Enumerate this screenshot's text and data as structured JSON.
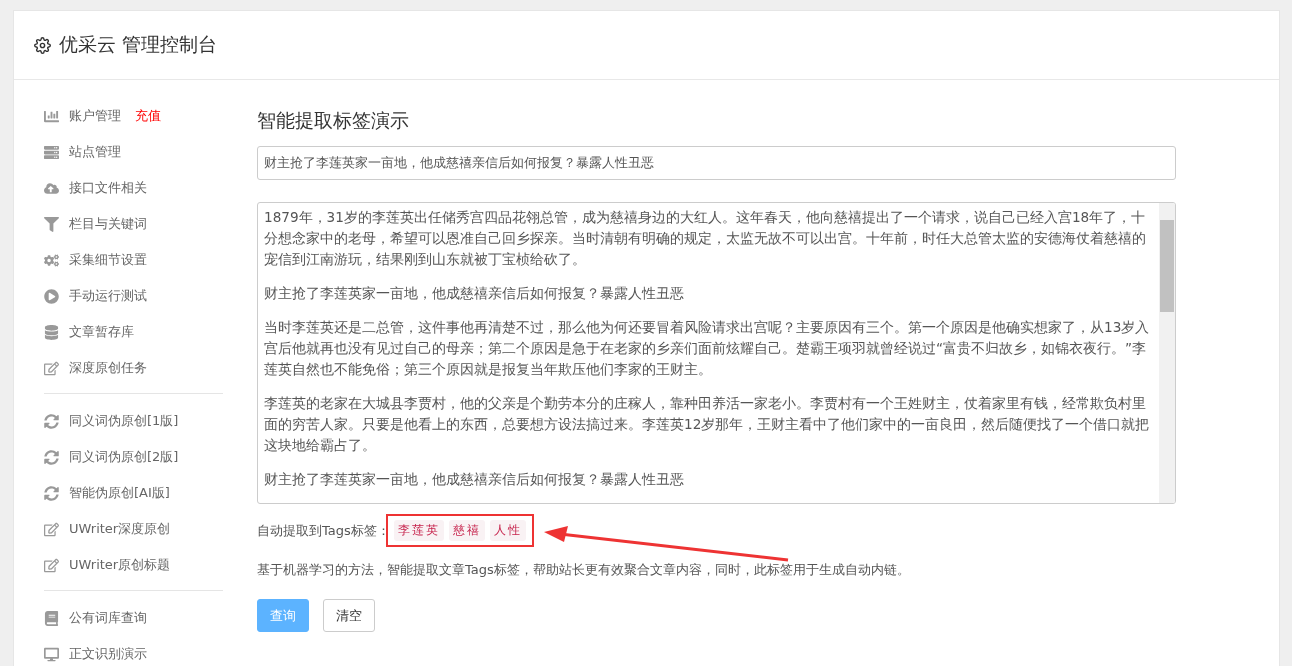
{
  "header": {
    "title": "优采云 管理控制台"
  },
  "sidebar": {
    "groups": [
      {
        "items": [
          {
            "label": "账户管理",
            "badge": "充值"
          },
          {
            "label": "站点管理"
          },
          {
            "label": "接口文件相关"
          },
          {
            "label": "栏目与关键词"
          },
          {
            "label": "采集细节设置"
          },
          {
            "label": "手动运行测试"
          },
          {
            "label": "文章暂存库"
          },
          {
            "label": "深度原创任务"
          }
        ]
      },
      {
        "items": [
          {
            "label": "同义词伪原创[1版]"
          },
          {
            "label": "同义词伪原创[2版]"
          },
          {
            "label": "智能伪原创[AI版]"
          },
          {
            "label": "UWriter深度原创"
          },
          {
            "label": "UWriter原创标题"
          }
        ]
      },
      {
        "items": [
          {
            "label": "公有词库查询"
          },
          {
            "label": "正文识别演示"
          }
        ]
      }
    ]
  },
  "main": {
    "title": "智能提取标签演示",
    "title_field": {
      "value": "财主抢了李莲英家一亩地，他成慈禧亲信后如何报复？暴露人性丑恶"
    },
    "content_field": {
      "paragraphs": [
        "1879年，31岁的李莲英出任储秀宫四品花翎总管，成为慈禧身边的大红人。这年春天，他向慈禧提出了一个请求，说自己已经入宫18年了，十分想念家中的老母，希望可以恩准自己回乡探亲。当时清朝有明确的规定，太监无故不可以出宫。十年前，时任大总管太监的安德海仗着慈禧的宠信到江南游玩，结果刚到山东就被丁宝桢给砍了。",
        "财主抢了李莲英家一亩地，他成慈禧亲信后如何报复？暴露人性丑恶",
        "当时李莲英还是二总管，这件事他再清楚不过，那么他为何还要冒着风险请求出宫呢？主要原因有三个。第一个原因是他确实想家了，从13岁入宫后他就再也没有见过自己的母亲；第二个原因是急于在老家的乡亲们面前炫耀自己。楚霸王项羽就曾经说过“富贵不归故乡，如锦衣夜行。”李莲英自然也不能免俗；第三个原因就是报复当年欺压他们李家的王财主。",
        "李莲英的老家在大城县李贾村，他的父亲是个勤劳本分的庄稼人，靠种田养活一家老小。李贾村有一个王姓财主，仗着家里有钱，经常欺负村里面的穷苦人家。只要是他看上的东西，总要想方设法搞过来。李莲英12岁那年，王财主看中了他们家中的一亩良田，然后随便找了一个借口就把这块地给霸占了。",
        "财主抢了李莲英家一亩地，他成慈禧亲信后如何报复？暴露人性丑恶"
      ]
    },
    "tags_label": "自动提取到Tags标签：",
    "tags": [
      "李莲英",
      "慈禧",
      "人性"
    ],
    "description": "基于机器学习的方法，智能提取文章Tags标签，帮助站长更有效聚合文章内容，同时，此标签用于生成自动内链。",
    "buttons": [
      {
        "label": "查询",
        "kind": "primary"
      },
      {
        "label": "清空",
        "kind": "default"
      }
    ]
  },
  "annotation": {
    "tags_highlighted": true,
    "arrow": true
  }
}
